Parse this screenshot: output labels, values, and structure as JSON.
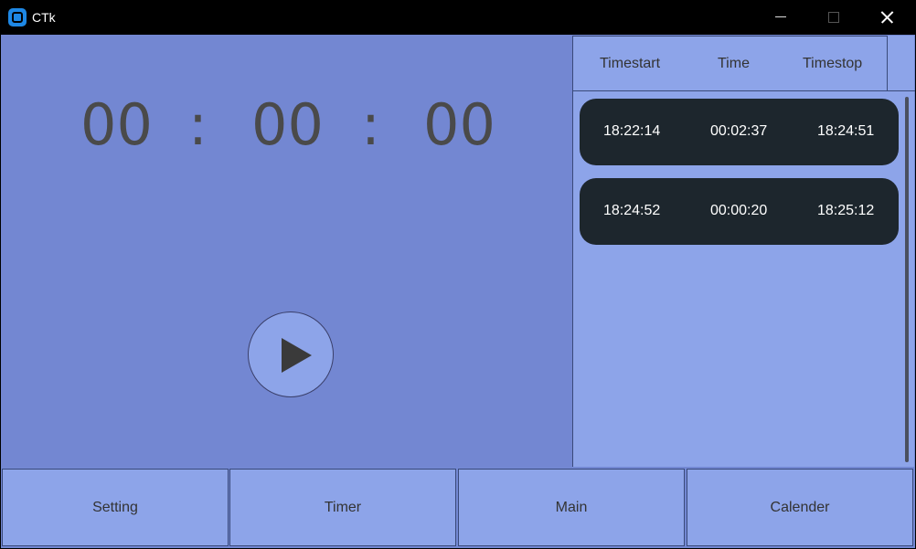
{
  "window": {
    "title": "CTk"
  },
  "timer": {
    "hours": "00",
    "minutes": "00",
    "seconds": "00",
    "separator": ":"
  },
  "log": {
    "headers": [
      "Timestart",
      "Time",
      "Timestop"
    ],
    "rows": [
      {
        "start": "18:22:14",
        "duration": "00:02:37",
        "stop": "18:24:51"
      },
      {
        "start": "18:24:52",
        "duration": "00:00:20",
        "stop": "18:25:12"
      }
    ]
  },
  "nav": {
    "items": [
      "Setting",
      "Timer",
      "Main",
      "Calender"
    ]
  },
  "colors": {
    "panel": "#7387d2",
    "accent": "#8da4e9",
    "row": "#1d262d",
    "titlebar": "#000000"
  }
}
